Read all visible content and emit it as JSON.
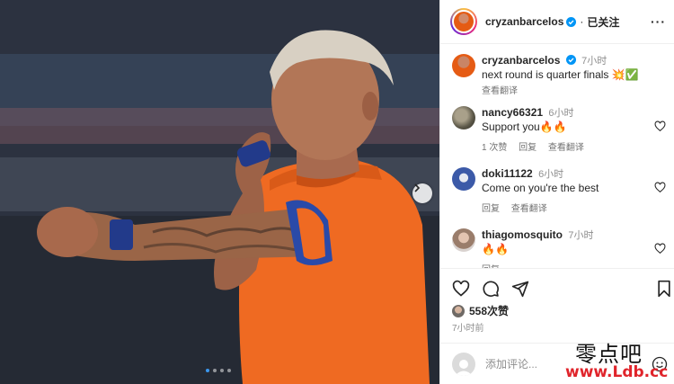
{
  "post": {
    "username": "cryzanbarcelos",
    "follow_status": "已关注",
    "carousel_dots": 4,
    "active_dot": 0
  },
  "comments": [
    {
      "user": "cryzanbarcelos",
      "verified": true,
      "time": "7小时",
      "text": "next round is quarter finals 💥✅",
      "meta": [
        "查看翻译"
      ]
    },
    {
      "user": "nancy66321",
      "verified": false,
      "time": "6小时",
      "text": "Support you🔥🔥",
      "meta": [
        "1 次赞",
        "回复",
        "查看翻译"
      ]
    },
    {
      "user": "doki11122",
      "verified": false,
      "time": "6小时",
      "text": "Come on you're the best",
      "meta": [
        "回复",
        "查看翻译"
      ]
    },
    {
      "user": "thiagomosquito",
      "verified": false,
      "time": "7小时",
      "text": "🔥🔥",
      "meta": [
        "回复"
      ]
    }
  ],
  "engagement": {
    "likes": "558次赞",
    "posted": "7小时前"
  },
  "add_comment": {
    "placeholder": "添加评论..."
  },
  "watermark": {
    "line1": "零点吧",
    "line2": "www.Ldb.cc"
  },
  "colors": {
    "jersey": "#ef6a22",
    "verified": "#0095f6",
    "watermark_red": "#e0242b"
  }
}
